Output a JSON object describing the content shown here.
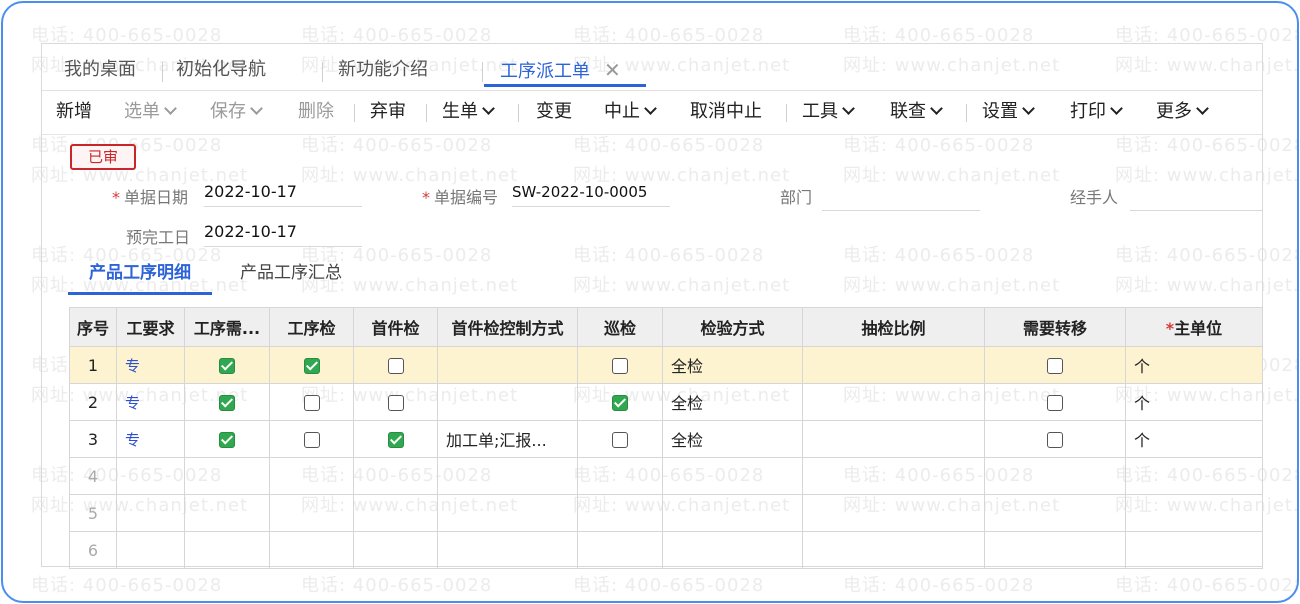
{
  "watermark": {
    "phone": "电话: 400-665-0028",
    "site": "网址: www.chanjet.net"
  },
  "tabs": [
    {
      "label": "我的桌面",
      "active": false
    },
    {
      "label": "初始化导航",
      "active": false
    },
    {
      "label": "新功能介绍",
      "active": false
    },
    {
      "label": "工序派工单",
      "active": true
    }
  ],
  "toolbar": {
    "add": "新增",
    "select": "选单",
    "save": "保存",
    "delete": "删除",
    "abandon_audit": "弃审",
    "generate": "生单",
    "change": "变更",
    "suspend": "中止",
    "cancel_suspend": "取消中止",
    "tools": "工具",
    "query": "联查",
    "settings": "设置",
    "print": "打印",
    "more": "更多"
  },
  "status": "已审",
  "form": {
    "date_label": "单据日期",
    "date_value": "2022-10-17",
    "code_label": "单据编号",
    "code_value": "SW-2022-10-0005",
    "dept_label": "部门",
    "dept_value": "",
    "handler_label": "经手人",
    "handler_value": "",
    "due_label": "预完工日",
    "due_value": "2022-10-17"
  },
  "subtabs": [
    {
      "label": "产品工序明细",
      "active": true
    },
    {
      "label": "产品工序汇总",
      "active": false
    }
  ],
  "grid": {
    "headers": [
      "序号",
      "工要求",
      "工序需...",
      "工序检",
      "首件检",
      "首件检控制方式",
      "巡检",
      "检验方式",
      "抽检比例",
      "需要转移",
      "主单位"
    ],
    "rows": [
      {
        "no": "1",
        "req": "专",
        "need": true,
        "proc_check": true,
        "first_check": false,
        "first_ctrl": "",
        "patrol": false,
        "method": "全检",
        "ratio": "",
        "transfer": false,
        "unit": "个",
        "selected": true
      },
      {
        "no": "2",
        "req": "专",
        "need": true,
        "proc_check": false,
        "first_check": false,
        "first_ctrl": "",
        "patrol": true,
        "method": "全检",
        "ratio": "",
        "transfer": false,
        "unit": "个",
        "selected": false
      },
      {
        "no": "3",
        "req": "专",
        "need": true,
        "proc_check": false,
        "first_check": true,
        "first_ctrl": "加工单;汇报...",
        "patrol": false,
        "method": "全检",
        "ratio": "",
        "transfer": false,
        "unit": "个",
        "selected": false
      }
    ],
    "empty_rows": [
      "4",
      "5",
      "6"
    ]
  },
  "colors": {
    "accent": "#2c63d8",
    "frame": "#4a8ff0",
    "status_red": "#c9262a",
    "check_green": "#2fa84f",
    "row_highlight": "#fdf3d0"
  }
}
